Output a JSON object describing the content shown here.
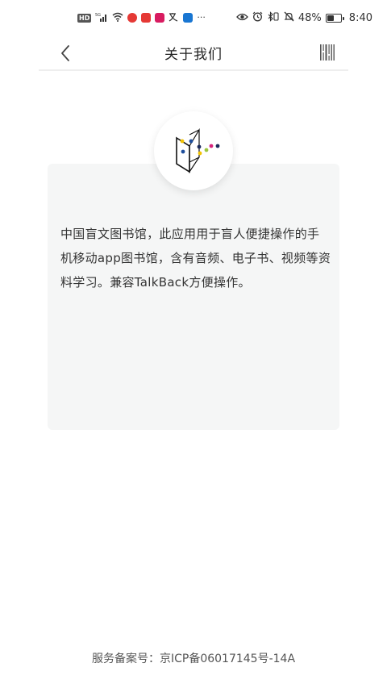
{
  "status_bar": {
    "battery_percent": "48%",
    "time": "8:40",
    "network": "5G",
    "battery_level": 0.48,
    "overflow": "···"
  },
  "header": {
    "title": "关于我们"
  },
  "about": {
    "description": "中国盲文图书馆，此应用用于盲人便捷操作的手机移动app图书馆，含有音频、电子书、视频等资料学习。兼容TalkBack方便操作。"
  },
  "footer": {
    "icp_text": "服务备案号：京ICP备06017145号-14A"
  },
  "colors": {
    "card_background": "#f5f6f6",
    "logo_yellow": "#f2c200",
    "logo_blue": "#1e4e9c",
    "logo_green": "#9bc53d",
    "logo_magenta": "#d6247b",
    "logo_navy": "#1b2a5a"
  }
}
